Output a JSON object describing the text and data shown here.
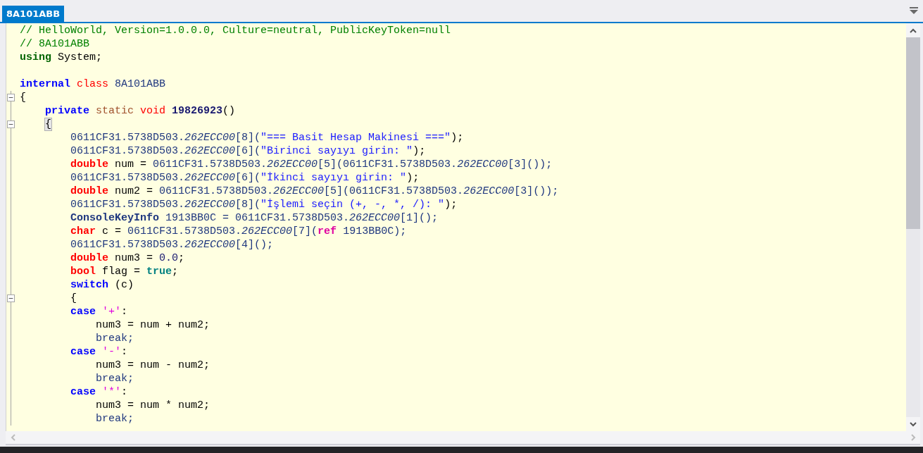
{
  "tabs": [
    {
      "label": "8A101ABB",
      "selected": true
    }
  ],
  "code_lines": [
    {
      "tokens": [
        {
          "text": "// HelloWorld, Version=1.0.0.0, Culture=neutral, PublicKeyToken=null",
          "kind": "comment"
        }
      ]
    },
    {
      "tokens": [
        {
          "text": "// 8A101ABB",
          "kind": "comment"
        }
      ]
    },
    {
      "tokens": [
        {
          "text": "using",
          "kind": "ns"
        },
        {
          "text": " System;",
          "kind": "plain"
        }
      ]
    },
    {
      "kind": "blank"
    },
    {
      "tokens": [
        {
          "text": "internal ",
          "kind": "kw"
        },
        {
          "text": "class ",
          "kind": "cls"
        },
        {
          "text": "8A101ABB",
          "kind": "ident"
        }
      ]
    },
    {
      "fold": true,
      "tokens": [
        {
          "text": "{",
          "kind": "plain"
        }
      ]
    },
    {
      "tokens": [
        {
          "text": "    private ",
          "kind": "kw"
        },
        {
          "text": "static ",
          "kind": "mod"
        },
        {
          "text": "void ",
          "kind": "cls"
        },
        {
          "text": "19826923",
          "kind": "member"
        },
        {
          "text": "()",
          "kind": "plain"
        }
      ]
    },
    {
      "fold": true,
      "highlighted": true,
      "tokens": [
        {
          "text": "    {",
          "kind": "plain"
        }
      ]
    },
    {
      "tokens": [
        {
          "text": "        0611CF31.5738D503.",
          "kind": "ident"
        },
        {
          "text": "262ECC00",
          "kind": "field"
        },
        {
          "text": "[8](",
          "kind": "ident"
        },
        {
          "text": "\"=== Basit Hesap Makinesi ===\"",
          "kind": "string"
        },
        {
          "text": ");",
          "kind": "plain"
        }
      ]
    },
    {
      "tokens": [
        {
          "text": "        0611CF31.5738D503.",
          "kind": "ident"
        },
        {
          "text": "262ECC00",
          "kind": "field"
        },
        {
          "text": "[6](",
          "kind": "ident"
        },
        {
          "text": "\"Birinci sayıyı girin: \"",
          "kind": "string"
        },
        {
          "text": ");",
          "kind": "plain"
        }
      ]
    },
    {
      "tokens": [
        {
          "text": "        double",
          "kind": "tkw"
        },
        {
          "text": " num = ",
          "kind": "plain"
        },
        {
          "text": "0611CF31.5738D503.",
          "kind": "ident"
        },
        {
          "text": "262ECC00",
          "kind": "field"
        },
        {
          "text": "[5](0611CF31.5738D503.",
          "kind": "ident"
        },
        {
          "text": "262ECC00",
          "kind": "field"
        },
        {
          "text": "[3]());",
          "kind": "ident"
        }
      ]
    },
    {
      "tokens": [
        {
          "text": "        0611CF31.5738D503.",
          "kind": "ident"
        },
        {
          "text": "262ECC00",
          "kind": "field"
        },
        {
          "text": "[6](",
          "kind": "ident"
        },
        {
          "text": "\"İkinci sayıyı girin: \"",
          "kind": "string"
        },
        {
          "text": ");",
          "kind": "plain"
        }
      ]
    },
    {
      "tokens": [
        {
          "text": "        double",
          "kind": "tkw"
        },
        {
          "text": " num2 = ",
          "kind": "plain"
        },
        {
          "text": "0611CF31.5738D503.",
          "kind": "ident"
        },
        {
          "text": "262ECC00",
          "kind": "field"
        },
        {
          "text": "[5](0611CF31.5738D503.",
          "kind": "ident"
        },
        {
          "text": "262ECC00",
          "kind": "field"
        },
        {
          "text": "[3]());",
          "kind": "ident"
        }
      ]
    },
    {
      "tokens": [
        {
          "text": "        0611CF31.5738D503.",
          "kind": "ident"
        },
        {
          "text": "262ECC00",
          "kind": "field"
        },
        {
          "text": "[8](",
          "kind": "ident"
        },
        {
          "text": "\"İşlemi seçin (+, -, *, /): \"",
          "kind": "string"
        },
        {
          "text": ");",
          "kind": "plain"
        }
      ]
    },
    {
      "tokens": [
        {
          "text": "        ConsoleKeyInfo",
          "kind": "type"
        },
        {
          "text": " 1913BB0C = 0611CF31.5738D503.",
          "kind": "ident"
        },
        {
          "text": "262ECC00",
          "kind": "field"
        },
        {
          "text": "[1]();",
          "kind": "ident"
        }
      ]
    },
    {
      "tokens": [
        {
          "text": "        char",
          "kind": "tkw"
        },
        {
          "text": " c = ",
          "kind": "plain"
        },
        {
          "text": "0611CF31.5738D503.",
          "kind": "ident"
        },
        {
          "text": "262ECC00",
          "kind": "field"
        },
        {
          "text": "[7](",
          "kind": "ident"
        },
        {
          "text": "ref",
          "kind": "ref"
        },
        {
          "text": " 1913BB0C);",
          "kind": "ident"
        }
      ]
    },
    {
      "tokens": [
        {
          "text": "        0611CF31.5738D503.",
          "kind": "ident"
        },
        {
          "text": "262ECC00",
          "kind": "field"
        },
        {
          "text": "[4]();",
          "kind": "ident"
        }
      ]
    },
    {
      "tokens": [
        {
          "text": "        double",
          "kind": "tkw"
        },
        {
          "text": " num3 = ",
          "kind": "plain"
        },
        {
          "text": "0.0",
          "kind": "num"
        },
        {
          "text": ";",
          "kind": "plain"
        }
      ]
    },
    {
      "tokens": [
        {
          "text": "        bool",
          "kind": "tkw"
        },
        {
          "text": " flag = ",
          "kind": "plain"
        },
        {
          "text": "true",
          "kind": "lit"
        },
        {
          "text": ";",
          "kind": "plain"
        }
      ]
    },
    {
      "tokens": [
        {
          "text": "        switch",
          "kind": "kw"
        },
        {
          "text": " (c)",
          "kind": "plain"
        }
      ]
    },
    {
      "fold": true,
      "tokens": [
        {
          "text": "        {",
          "kind": "plain"
        }
      ]
    },
    {
      "tokens": [
        {
          "text": "        case ",
          "kind": "kw"
        },
        {
          "text": "'+'",
          "kind": "char"
        },
        {
          "text": ":",
          "kind": "plain"
        }
      ]
    },
    {
      "tokens": [
        {
          "text": "            num3 = num + num2;",
          "kind": "plain"
        }
      ]
    },
    {
      "tokens": [
        {
          "text": "            break;",
          "kind": "ident"
        }
      ]
    },
    {
      "tokens": [
        {
          "text": "        case ",
          "kind": "kw"
        },
        {
          "text": "'-'",
          "kind": "char"
        },
        {
          "text": ":",
          "kind": "plain"
        }
      ]
    },
    {
      "tokens": [
        {
          "text": "            num3 = num - num2;",
          "kind": "plain"
        }
      ]
    },
    {
      "tokens": [
        {
          "text": "            break;",
          "kind": "ident"
        }
      ]
    },
    {
      "tokens": [
        {
          "text": "        case ",
          "kind": "kw"
        },
        {
          "text": "'*'",
          "kind": "char"
        },
        {
          "text": ":",
          "kind": "plain"
        }
      ]
    },
    {
      "tokens": [
        {
          "text": "            num3 = num * num2;",
          "kind": "plain"
        }
      ]
    },
    {
      "tokens": [
        {
          "text": "            break;",
          "kind": "ident"
        }
      ]
    }
  ]
}
